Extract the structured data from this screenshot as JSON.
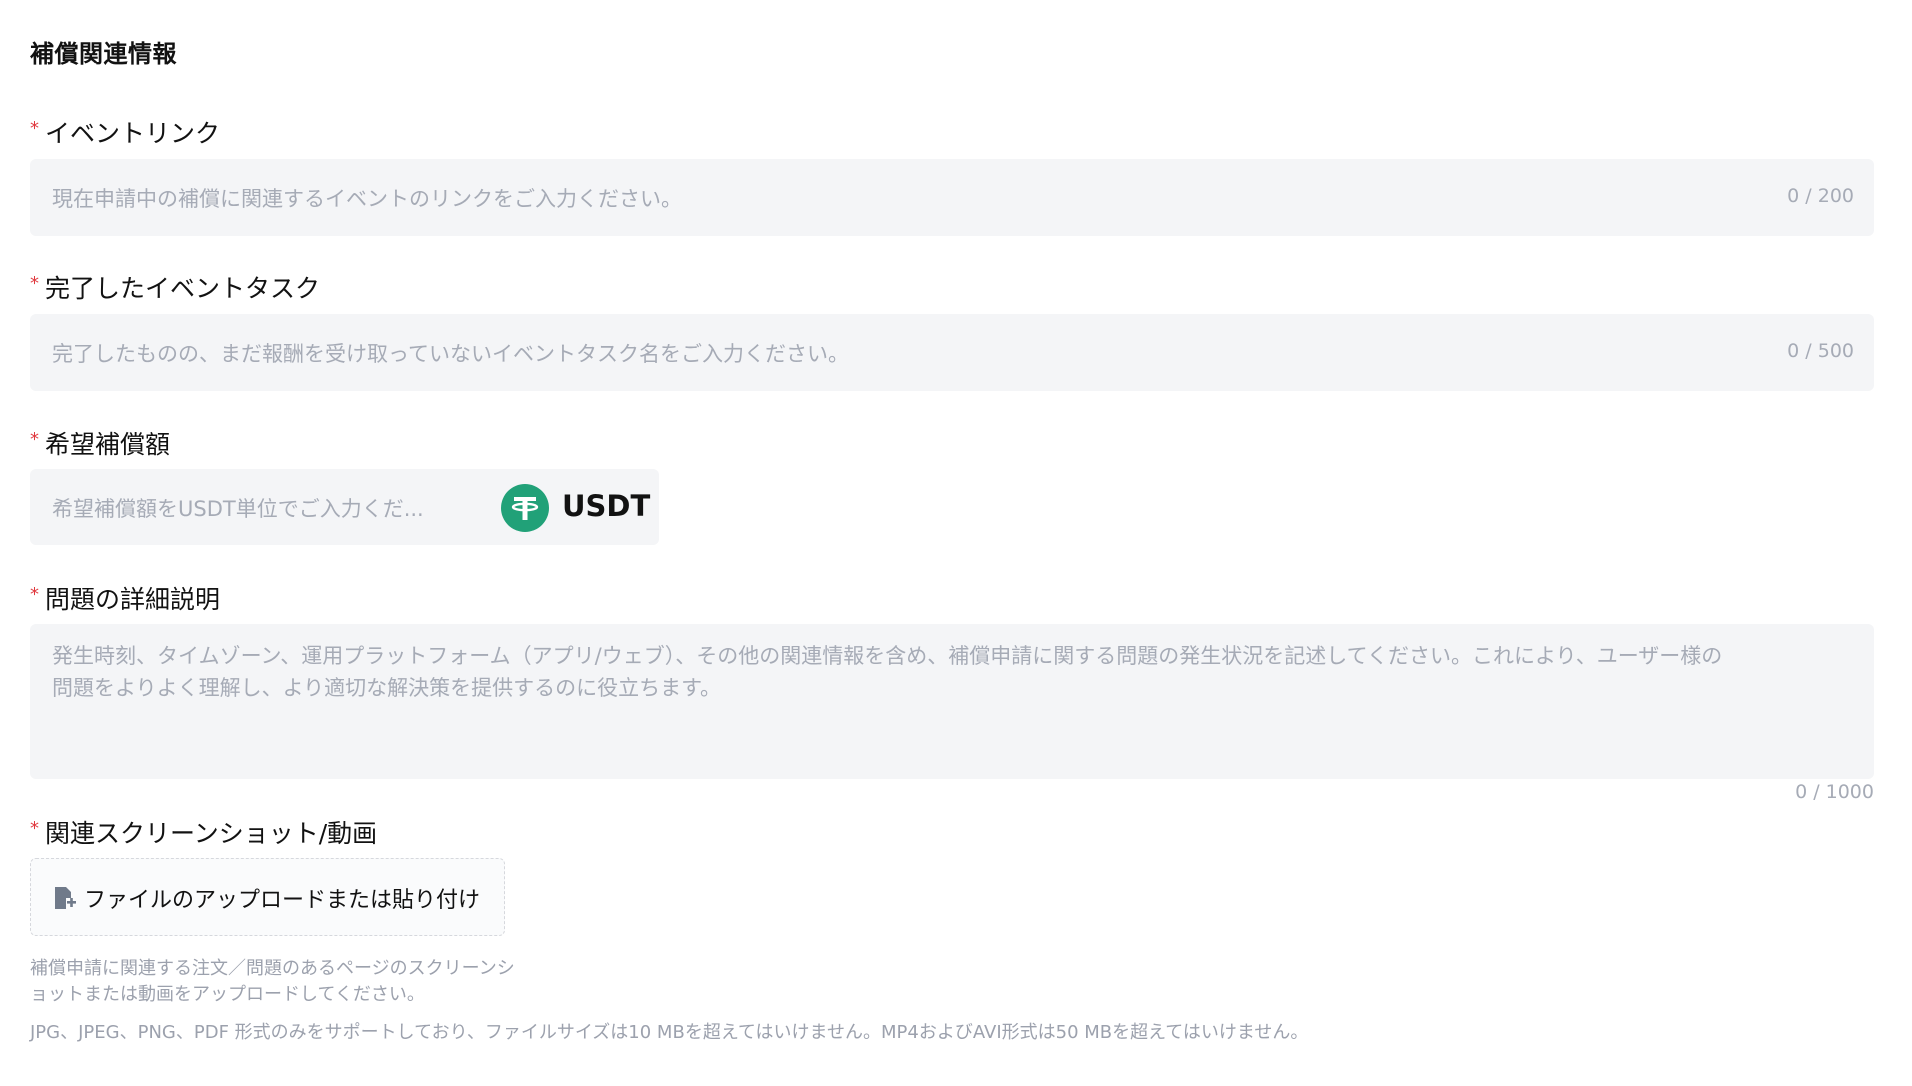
{
  "section_title": "補償関連情報",
  "required_mark": "*",
  "event_link": {
    "label": "イベントリンク",
    "placeholder": "現在申請中の補償に関連するイベントのリンクをご入力ください。",
    "counter": "0 / 200"
  },
  "event_task": {
    "label": "完了したイベントタスク",
    "placeholder": "完了したものの、まだ報酬を受け取っていないイベントタスク名をご入力ください。",
    "counter": "0 / 500"
  },
  "compensation": {
    "label": "希望補償額",
    "placeholder": "希望補償額をUSDT単位でご入力くだ...",
    "currency": "USDT",
    "currency_icon": "tether-icon",
    "currency_color": "#21a178"
  },
  "description": {
    "label": "問題の詳細説明",
    "placeholder_line1": "発生時刻、タイムゾーン、運用プラットフォーム（アプリ/ウェブ）、その他の関連情報を含め、補償申請に関する問題の発生状況を記述してください。これにより、ユーザー様の",
    "placeholder_line2": "問題をよりよく理解し、より適切な解決策を提供するのに役立ちます。",
    "counter": "0 / 1000"
  },
  "attachments": {
    "label": "関連スクリーンショット/動画",
    "upload_label": "ファイルのアップロードまたは貼り付け",
    "upload_icon": "file-add-icon",
    "hint_line1": "補償申請に関連する注文／問題のあるページのスクリーンシ",
    "hint_line2": "ョットまたは動画をアップロードしてください。",
    "formats": "JPG、JPEG、PNG、PDF 形式のみをサポートしており、ファイルサイズは10 MBを超えてはいけません。MP4およびAVI形式は50 MBを超えてはいけません。"
  }
}
